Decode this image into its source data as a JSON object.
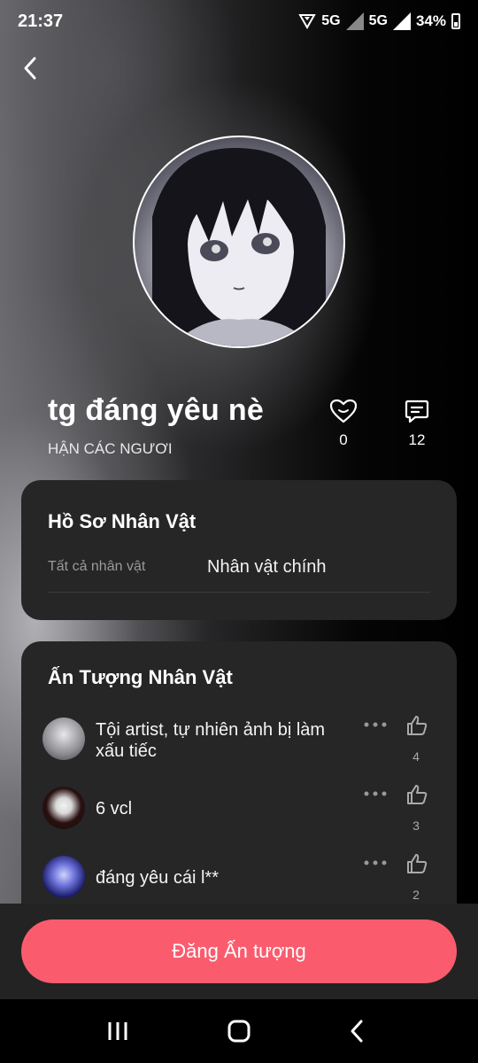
{
  "status_bar": {
    "time": "21:37",
    "network1": "5G",
    "network2": "5G",
    "battery": "34%"
  },
  "profile": {
    "name": "tg đáng yêu nè",
    "subtitle": "HẬN CÁC NGƯƠI",
    "likes": "0",
    "comments": "12"
  },
  "character_profile": {
    "title": "Hồ Sơ Nhân Vật",
    "label": "Tất cả nhân vật",
    "value": "Nhân vật chính"
  },
  "impressions": {
    "title": "Ấn Tượng Nhân Vật",
    "items": [
      {
        "text": "Tội artist, tự nhiên ảnh bị làm xấu tiếc",
        "likes": "4"
      },
      {
        "text": "6 vcl",
        "likes": "3"
      },
      {
        "text": "đáng yêu cái l**",
        "likes": "2"
      }
    ]
  },
  "cta": {
    "label": "Đăng Ấn tượng"
  },
  "colors": {
    "accent": "#fa5c6e",
    "card": "#262626"
  }
}
